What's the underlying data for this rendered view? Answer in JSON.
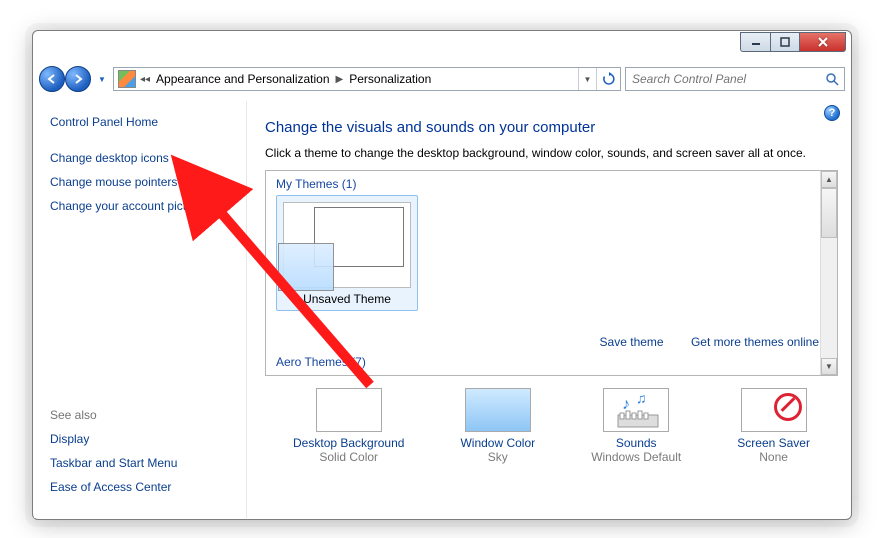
{
  "breadcrumb": {
    "level1": "Appearance and Personalization",
    "level2": "Personalization"
  },
  "search": {
    "placeholder": "Search Control Panel"
  },
  "sidebar": {
    "home": "Control Panel Home",
    "tasks": [
      "Change desktop icons",
      "Change mouse pointers",
      "Change your account picture"
    ],
    "seealso_header": "See also",
    "seealso": [
      "Display",
      "Taskbar and Start Menu",
      "Ease of Access Center"
    ]
  },
  "main": {
    "heading": "Change the visuals and sounds on your computer",
    "subtitle": "Click a theme to change the desktop background, window color, sounds, and screen saver all at once.",
    "my_themes_label": "My Themes (1)",
    "theme_name": "Unsaved Theme",
    "save_theme": "Save theme",
    "get_more": "Get more themes online",
    "aero_label": "Aero Themes (7)"
  },
  "bottom": {
    "bg_label": "Desktop Background",
    "bg_value": "Solid Color",
    "wc_label": "Window Color",
    "wc_value": "Sky",
    "snd_label": "Sounds",
    "snd_value": "Windows Default",
    "ss_label": "Screen Saver",
    "ss_value": "None"
  }
}
